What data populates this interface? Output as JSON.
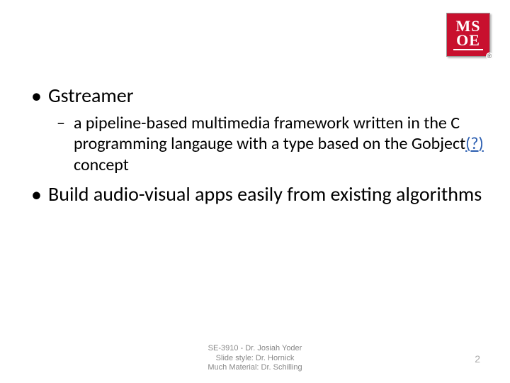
{
  "logo": {
    "line1": "MS",
    "line2": "OE",
    "reg": "®"
  },
  "bullets": [
    {
      "text": "Gstreamer",
      "sub": [
        {
          "prefix": "a pipeline-based multimedia framework written in the C programming langauge with a type based on the Gobject",
          "link_open": "(",
          "link_q": "?",
          "link_close": ")",
          "suffix": " concept"
        }
      ]
    },
    {
      "text": "Build audio-visual apps easily from existing algorithms",
      "sub": []
    }
  ],
  "footer": {
    "line1": "SE-3910  -  Dr. Josiah Yoder",
    "line2": "Slide style: Dr. Hornick",
    "line3": "Much Material: Dr. Schilling"
  },
  "page_number": "2"
}
